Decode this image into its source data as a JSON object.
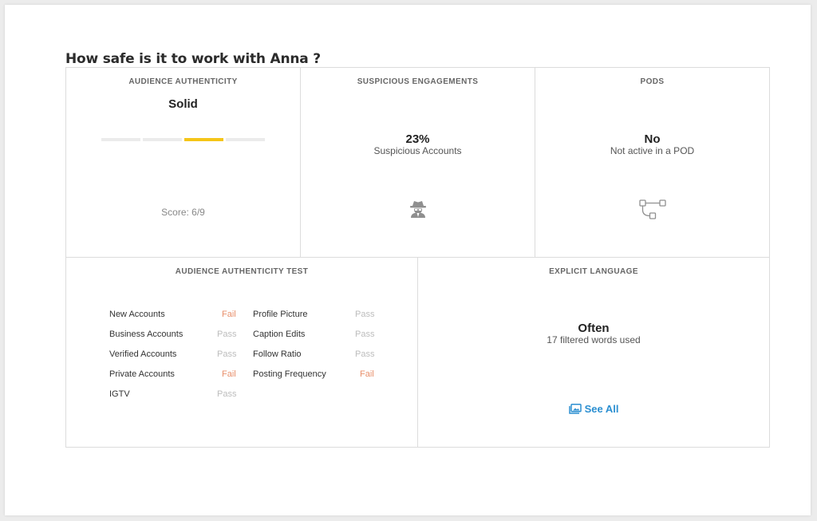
{
  "page": {
    "title": "How safe is it to work with Anna ?"
  },
  "audience_authenticity": {
    "header": "AUDIENCE AUTHENTICITY",
    "rating": "Solid",
    "score_text": "Score: 6/9",
    "level_segments": [
      false,
      false,
      true,
      false
    ]
  },
  "suspicious_engagements": {
    "header": "SUSPICIOUS ENGAGEMENTS",
    "value": "23%",
    "caption": "Suspicious Accounts",
    "icon": "spy-icon"
  },
  "pods": {
    "header": "PODS",
    "value": "No",
    "caption": "Not active in a POD",
    "icon": "network-icon"
  },
  "authenticity_test": {
    "header": "AUDIENCE AUTHENTICITY TEST",
    "left": [
      {
        "label": "New Accounts",
        "result": "Fail"
      },
      {
        "label": "Business Accounts",
        "result": "Pass"
      },
      {
        "label": "Verified Accounts",
        "result": "Pass"
      },
      {
        "label": "Private Accounts",
        "result": "Fail"
      },
      {
        "label": "IGTV",
        "result": "Pass"
      }
    ],
    "right": [
      {
        "label": "Profile Picture",
        "result": "Pass"
      },
      {
        "label": "Caption Edits",
        "result": "Pass"
      },
      {
        "label": "Follow Ratio",
        "result": "Pass"
      },
      {
        "label": "Posting Frequency",
        "result": "Fail"
      }
    ]
  },
  "explicit_language": {
    "header": "EXPLICIT LANGUAGE",
    "value": "Often",
    "caption": "17 filtered words used",
    "link_label": "See All"
  },
  "colors": {
    "accent_yellow": "#f5c518",
    "fail": "#e8906c",
    "pass": "#bdbdbd",
    "link": "#2b8fd1"
  }
}
